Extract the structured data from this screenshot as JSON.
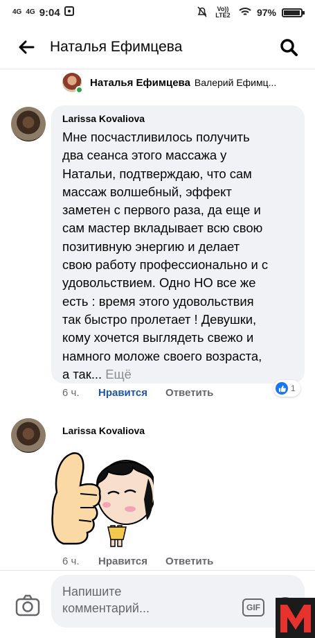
{
  "status_bar": {
    "net_left": "4G",
    "net_right": "4G",
    "time": "9:04",
    "lte_label": "Vo)) LTE2",
    "battery": "97%",
    "battery_level": 0.97
  },
  "header": {
    "title": "Наталья Ефимцева"
  },
  "post_context": {
    "name": "Наталья Ефимцева",
    "subtitle": "Валерий Ефимц..."
  },
  "comments": [
    {
      "author": "Larissa Kovaliova",
      "text": "Мне посчастливилось получить\nдва сеанса этого массажа у\nНатальи, подтверждаю, что сам\nмассаж волшебный, эффект\nзаметен с первого раза, да еще и\nсам  мастер вкладывает всю свою\nпозитивную энергию и делает\nсвою работу  профессионально и с\nудовольствием. Одно НО все же\nесть : время этого удовольствия\nтак быстро пролетает ! Девушки,\nкому хочется выглядеть свежо и\nнамного моложе своего возраста,\nа так...",
      "more": " Ещё",
      "time": "6 ч.",
      "like": "Нравится",
      "reply": "Ответить",
      "reactions": "1"
    },
    {
      "author": "Larissa Kovaliova",
      "time": "6 ч.",
      "like": "Нравится",
      "reply": "Ответить"
    }
  ],
  "composer": {
    "placeholder": "Напишите\nкомментарий...",
    "gif_label": "GIF"
  },
  "watermark": "M",
  "colors": {
    "accent": "#1877f2",
    "bubble": "#f0f2f5",
    "secondary_text": "#65676b"
  }
}
